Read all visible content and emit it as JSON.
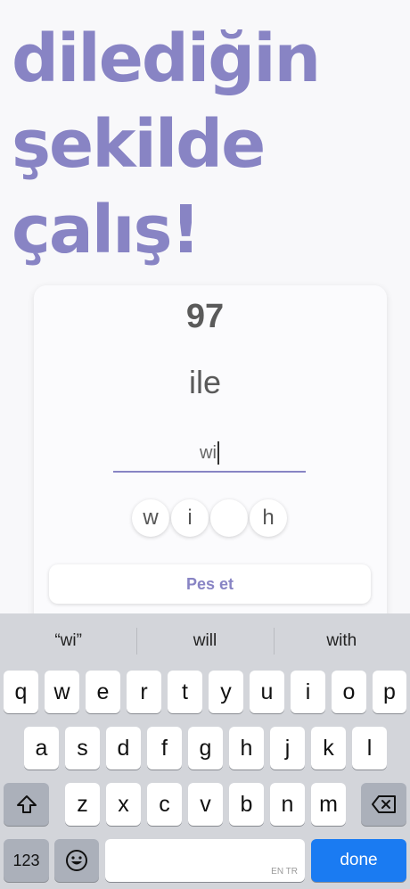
{
  "headline": {
    "line1": "dilediğin",
    "line2": "şekilde",
    "line3": "çalış!"
  },
  "card": {
    "count": "97",
    "word": "ile",
    "answer_value": "wi",
    "hints": [
      "w",
      "i",
      "",
      "h"
    ],
    "giveup_label": "Pes et"
  },
  "keyboard": {
    "suggestions": [
      "“wi”",
      "will",
      "with"
    ],
    "row1": [
      "q",
      "w",
      "e",
      "r",
      "t",
      "y",
      "u",
      "i",
      "o",
      "p"
    ],
    "row2": [
      "a",
      "s",
      "d",
      "f",
      "g",
      "h",
      "j",
      "k",
      "l"
    ],
    "row3": [
      "z",
      "x",
      "c",
      "v",
      "b",
      "n",
      "m"
    ],
    "numbers_label": "123",
    "space_lang": "EN TR",
    "done_label": "done",
    "shift_icon": "shift-icon",
    "backspace_icon": "backspace-icon",
    "emoji_icon": "emoji-icon"
  },
  "colors": {
    "accent": "#8884c4",
    "done_blue": "#1a7bf2",
    "keyboard_bg": "#d3d5da"
  }
}
